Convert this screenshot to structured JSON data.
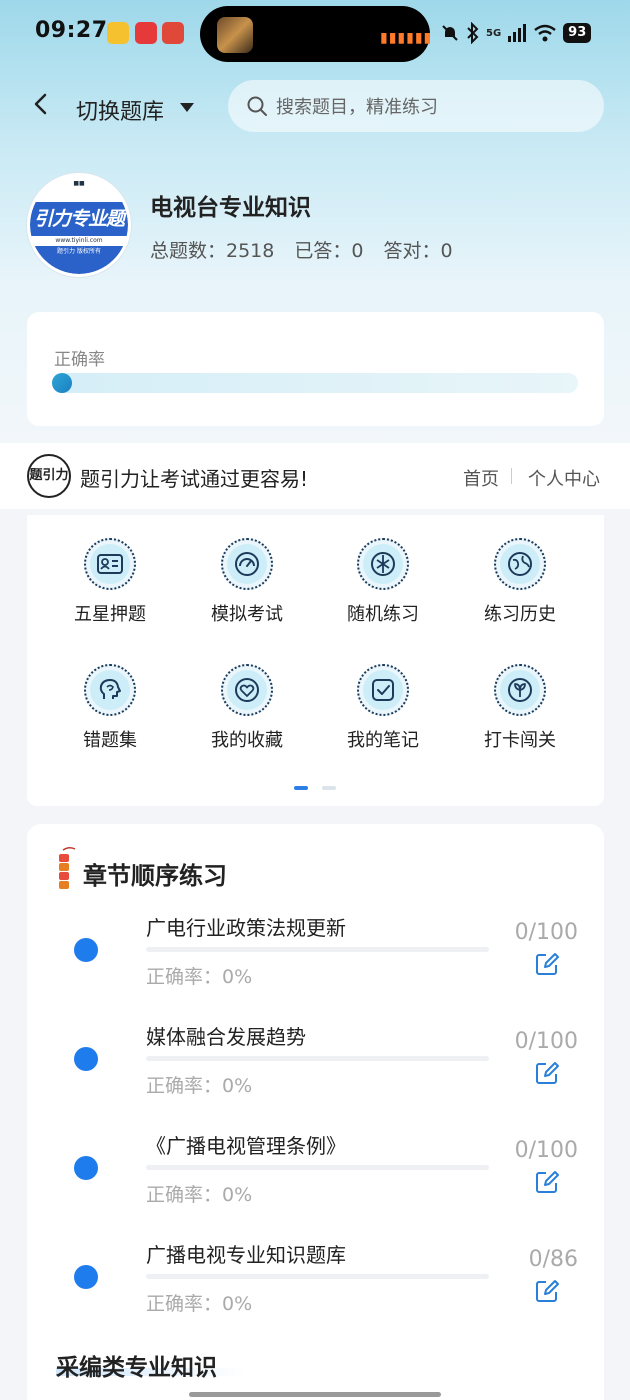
{
  "status_bar": {
    "time": "09:27",
    "battery": "93",
    "network": "5G"
  },
  "header": {
    "switch_label": "切换题库",
    "search_placeholder": "搜索题目，精准练习"
  },
  "bank": {
    "logo_text": "引力专业题",
    "logo_url": "www.tiyinli.com",
    "logo_footer": "题引力 版权所有",
    "title": "电视台专业知识",
    "total_label": "总题数：2518",
    "answered_label": "已答：0",
    "correct_label": "答对：0"
  },
  "accuracy": {
    "label": "正确率",
    "value": 0
  },
  "brand": {
    "logo_text": "题引力",
    "slogan": "题引力让考试通过更容易!",
    "nav_home": "首页",
    "nav_me": "个人中心"
  },
  "features": [
    {
      "label": "五星押题",
      "icon": "id-card-icon"
    },
    {
      "label": "模拟考试",
      "icon": "gauge-icon"
    },
    {
      "label": "随机练习",
      "icon": "shuffle-icon"
    },
    {
      "label": "练习历史",
      "icon": "globe-icon"
    },
    {
      "label": "错题集",
      "icon": "head-icon"
    },
    {
      "label": "我的收藏",
      "icon": "heart-icon"
    },
    {
      "label": "我的笔记",
      "icon": "note-check-icon"
    },
    {
      "label": "打卡闯关",
      "icon": "leaf-icon"
    }
  ],
  "chapters": {
    "title": "章节顺序练习",
    "items": [
      {
        "name": "广电行业政策法规更新",
        "accuracy": "正确率：0%",
        "count": "0/100"
      },
      {
        "name": "媒体融合发展趋势",
        "accuracy": "正确率：0%",
        "count": "0/100"
      },
      {
        "name": "《广播电视管理条例》",
        "accuracy": "正确率：0%",
        "count": "0/100"
      },
      {
        "name": "广播电视专业知识题库",
        "accuracy": "正确率：0%",
        "count": "0/86"
      }
    ]
  },
  "next_section": {
    "title": "采编类专业知识"
  },
  "colors": {
    "accent": "#1f7cec",
    "header_gradient_top": "#9ed8ea"
  }
}
